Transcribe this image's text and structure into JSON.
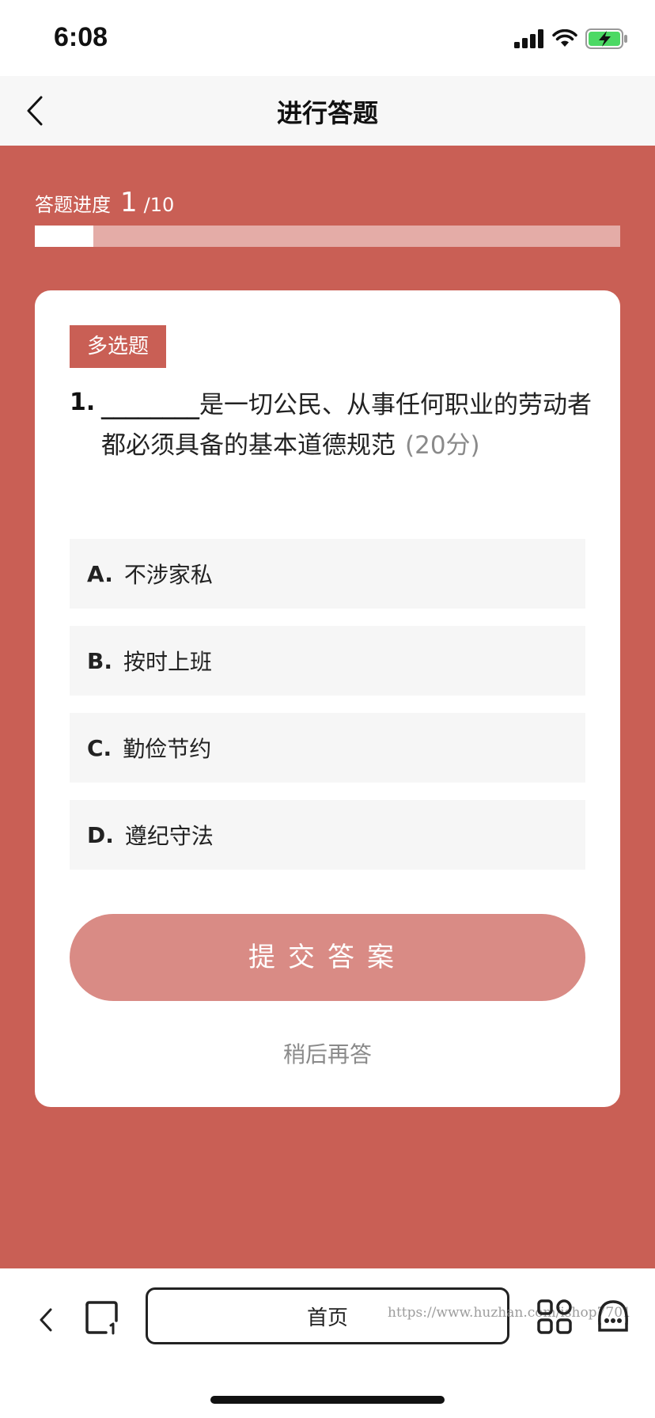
{
  "status_bar": {
    "time": "6:08"
  },
  "nav": {
    "title": "进行答题"
  },
  "progress": {
    "label": "答题进度",
    "current": "1",
    "total": "/10",
    "fraction": 0.1
  },
  "question": {
    "type": "多选题",
    "number": "1.",
    "blank": "________",
    "text": "是一切公民、从事任何职业的劳动者都必须具备的基本道德规范",
    "score": "(20分)",
    "options": [
      {
        "letter": "A.",
        "text": "不涉家私"
      },
      {
        "letter": "B.",
        "text": "按时上班"
      },
      {
        "letter": "C.",
        "text": "勤俭节约"
      },
      {
        "letter": "D.",
        "text": "遵纪守法"
      }
    ]
  },
  "actions": {
    "submit_label": "提交答案",
    "later_label": "稍后再答"
  },
  "browser_bar": {
    "home_label": "首页",
    "watermark": "https://www.huzhan.com/ishop7701"
  },
  "colors": {
    "primary": "#c95f55",
    "progress_track": "#e4aca7",
    "submit_button": "#d98b85",
    "option_bg": "#f6f6f6"
  },
  "icons": [
    "signal-icon",
    "wifi-icon",
    "battery-charging-icon",
    "back-arrow-icon",
    "tabs-icon",
    "apps-grid-icon",
    "more-icon"
  ]
}
